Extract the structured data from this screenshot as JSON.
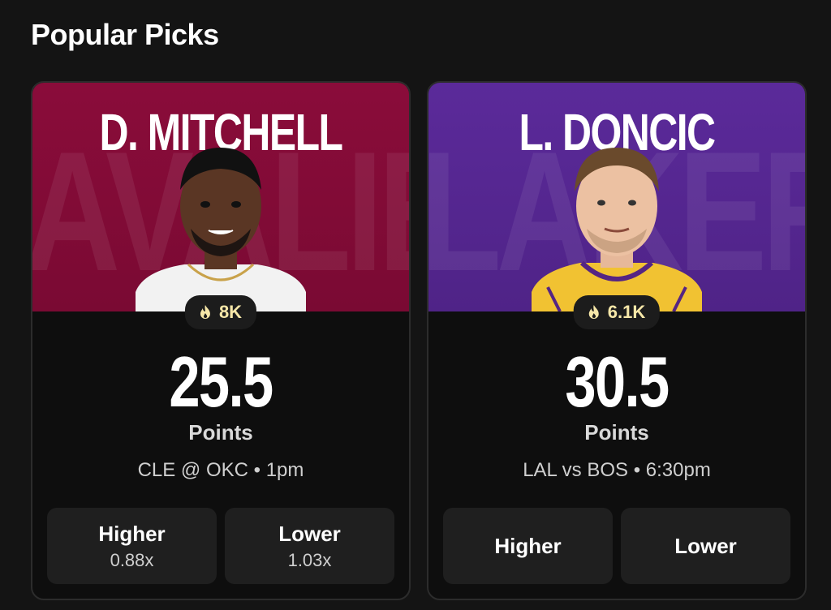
{
  "section": {
    "title": "Popular Picks"
  },
  "cards": [
    {
      "player_name": "D. MITCHELL",
      "team_watermark": "AVALIER",
      "team_color": "#8a0c3a",
      "popularity": "8K",
      "line": "25.5",
      "stat": "Points",
      "matchup": "CLE @ OKC • 1pm",
      "higher_label": "Higher",
      "higher_multiplier": "0.88x",
      "lower_label": "Lower",
      "lower_multiplier": "1.03x"
    },
    {
      "player_name": "L. DONCIC",
      "team_watermark": "LAKERS",
      "team_color": "#5b2a9a",
      "popularity": "6.1K",
      "line": "30.5",
      "stat": "Points",
      "matchup": "LAL vs BOS • 6:30pm",
      "higher_label": "Higher",
      "lower_label": "Lower"
    }
  ],
  "icons": {
    "popularity": "flame-icon",
    "player_photo": "player-headshot"
  },
  "colors": {
    "background": "#141414",
    "popularity_text": "#f6e7a8"
  }
}
